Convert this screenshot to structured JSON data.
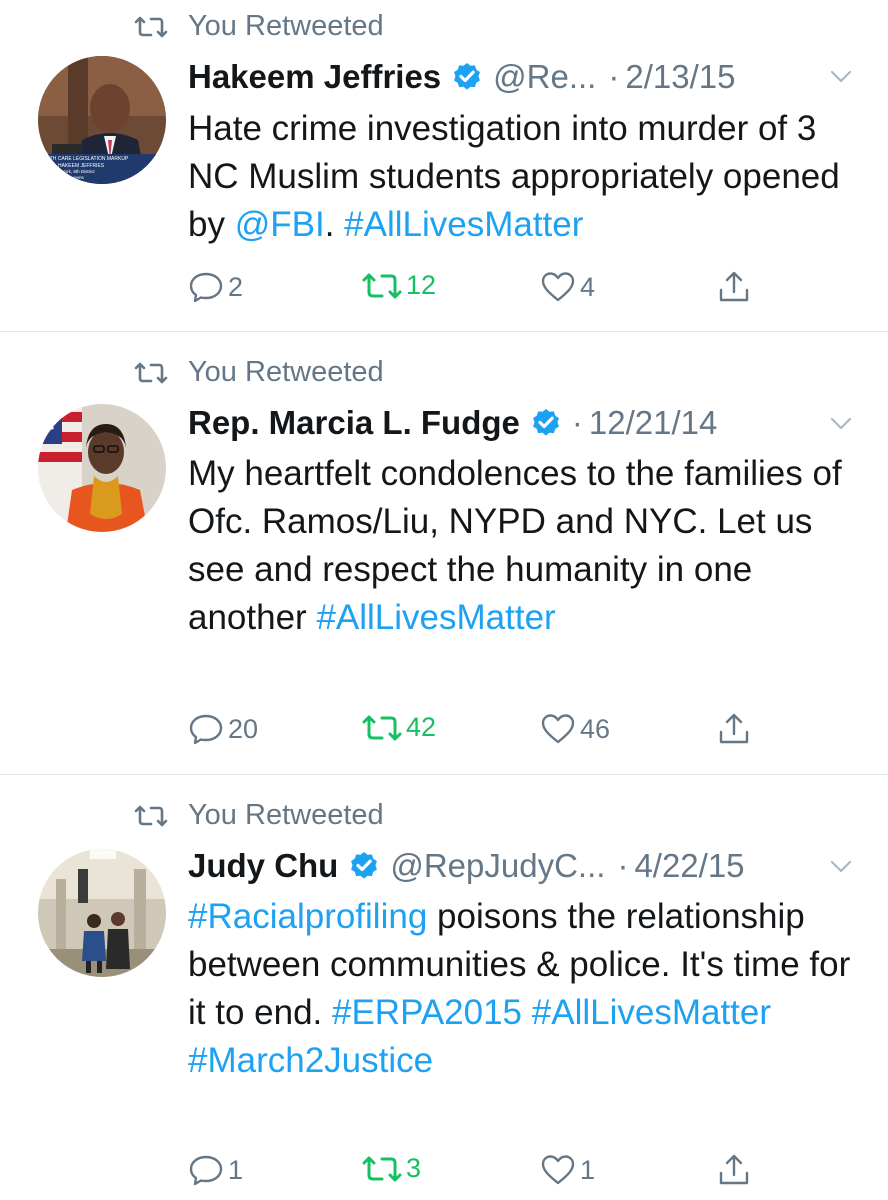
{
  "tweets": [
    {
      "retweet_label": "You Retweeted",
      "name": "Hakeem Jeffries",
      "handle": "@Re...",
      "date": "2/13/15",
      "text": [
        {
          "t": "Hate crime investigation into murder of 3 NC Muslim students appropriately opened by ",
          "link": false
        },
        {
          "t": "@FBI",
          "link": true
        },
        {
          "t": ". ",
          "link": false
        },
        {
          "t": "#AllLivesMatter",
          "link": true
        }
      ],
      "replies": "2",
      "retweets": "12",
      "likes": "4",
      "avatar_caption": [
        "ALTH CARE LEGISLATION MARKUP",
        "HAKEEM JEFFRIES",
        "York, 8th District",
        "Queens"
      ]
    },
    {
      "retweet_label": "You Retweeted",
      "name": "Rep. Marcia L. Fudge",
      "handle": "",
      "date": "12/21/14",
      "text": [
        {
          "t": "My heartfelt condolences to the families of Ofc. Ramos/Liu, NYPD and NYC. Let us see and respect the humanity in one another ",
          "link": false
        },
        {
          "t": "#AllLivesMatter",
          "link": true
        }
      ],
      "replies": "20",
      "retweets": "42",
      "likes": "46"
    },
    {
      "retweet_label": "You Retweeted",
      "name": "Judy Chu",
      "handle": "@RepJudyC...",
      "date": "4/22/15",
      "text": [
        {
          "t": "#Racialprofiling",
          "link": true
        },
        {
          "t": " poisons the relationship between communities & police. It's time for it to end. ",
          "link": false
        },
        {
          "t": "#ERPA2015",
          "link": true
        },
        {
          "t": " ",
          "link": false
        },
        {
          "t": "#AllLivesMatter",
          "link": true
        },
        {
          "t": " ",
          "link": false
        },
        {
          "t": "#March2Justice",
          "link": true
        }
      ],
      "replies": "1",
      "retweets": "3",
      "likes": "1"
    }
  ],
  "icons": {
    "retweet": "retweet-icon",
    "verified": "verified-badge-icon",
    "reply": "reply-icon",
    "like": "heart-icon",
    "share": "share-icon",
    "caret": "chevron-down-icon"
  },
  "colors": {
    "link": "#1da1f2",
    "retweet_green": "#17bf63",
    "muted": "#657786",
    "text": "#14171a",
    "divider": "#e1e8ed"
  }
}
